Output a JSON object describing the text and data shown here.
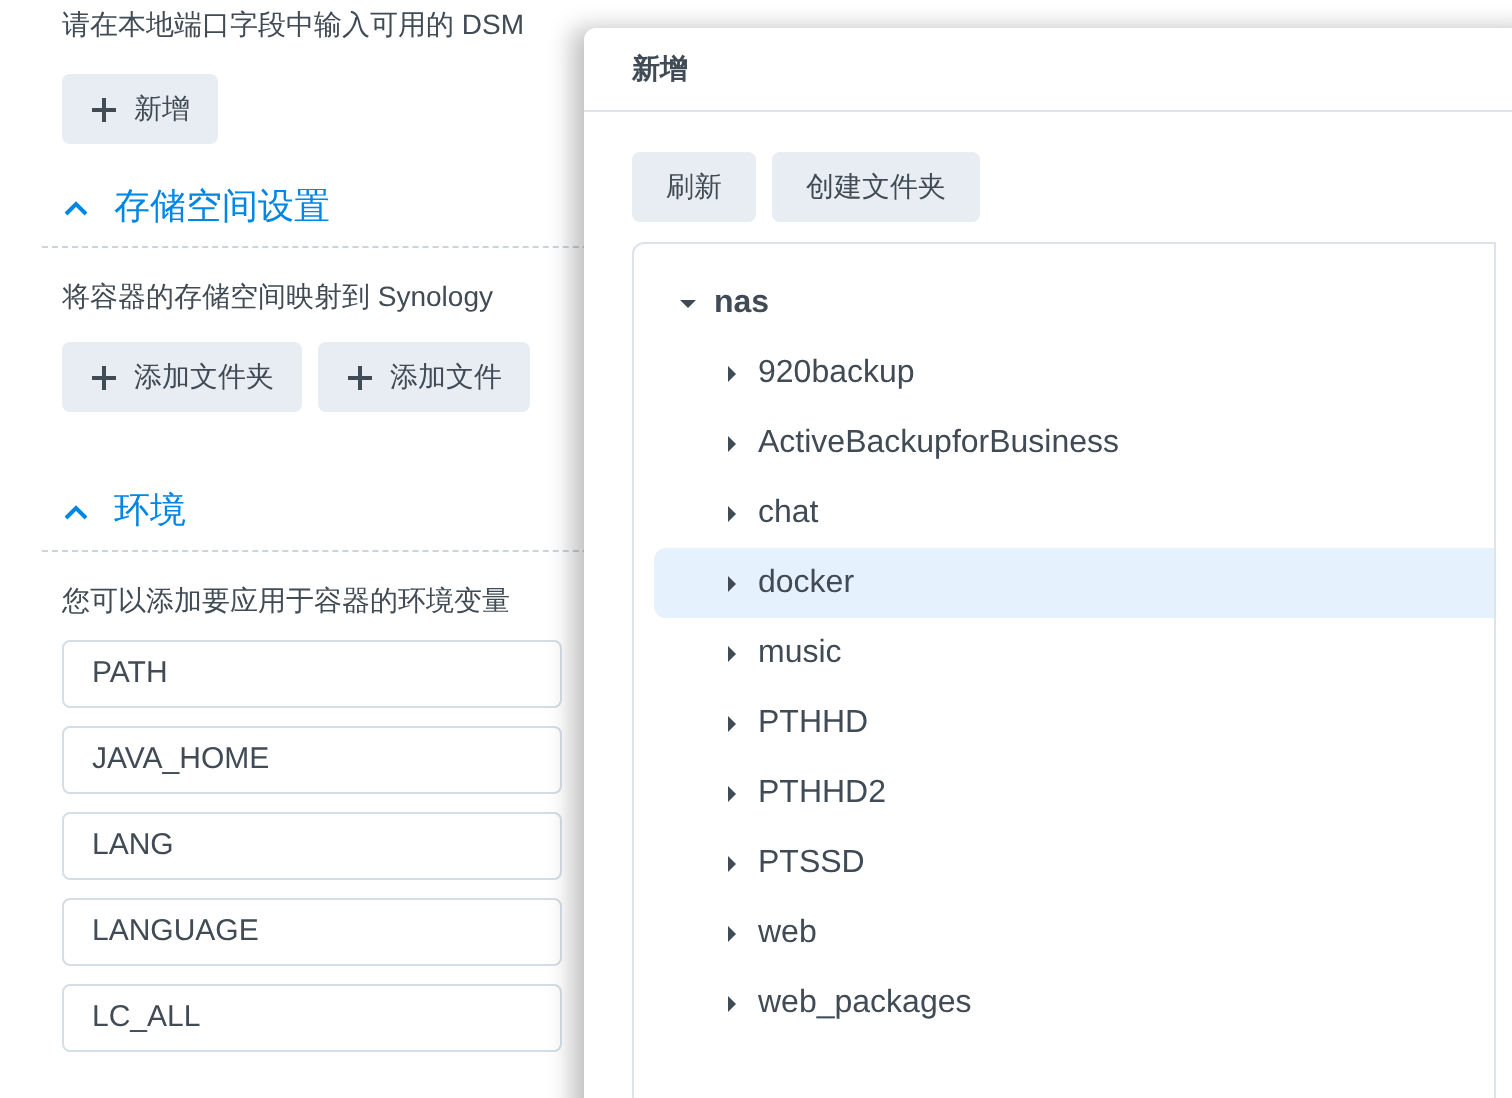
{
  "page": {
    "port_hint": "请在本地端口字段中输入可用的 DSM",
    "add_port_button": "新增",
    "storage": {
      "title": "存储空间设置",
      "expanded": true,
      "description": "将容器的存储空间映射到 Synology",
      "buttons": [
        "添加文件夹",
        "添加文件"
      ]
    },
    "environment": {
      "title": "环境",
      "expanded": true,
      "description": "您可以添加要应用于容器的环境变量",
      "variables": [
        "PATH",
        "JAVA_HOME",
        "LANG",
        "LANGUAGE",
        "LC_ALL"
      ]
    }
  },
  "dialog": {
    "title": "新增",
    "buttons": [
      "刷新",
      "创建文件夹"
    ],
    "tree": [
      {
        "label": "nas",
        "expanded": true,
        "selected": false,
        "children": [
          {
            "label": "920backup",
            "expanded": false,
            "selected": false
          },
          {
            "label": "ActiveBackupforBusiness",
            "expanded": false,
            "selected": false
          },
          {
            "label": "chat",
            "expanded": false,
            "selected": false
          },
          {
            "label": "docker",
            "expanded": false,
            "selected": true
          },
          {
            "label": "music",
            "expanded": false,
            "selected": false
          },
          {
            "label": "PTHHD",
            "expanded": false,
            "selected": false
          },
          {
            "label": "PTHHD2",
            "expanded": false,
            "selected": false
          },
          {
            "label": "PTSSD",
            "expanded": false,
            "selected": false
          },
          {
            "label": "web",
            "expanded": false,
            "selected": false
          },
          {
            "label": "web_packages",
            "expanded": false,
            "selected": false
          }
        ]
      }
    ]
  }
}
